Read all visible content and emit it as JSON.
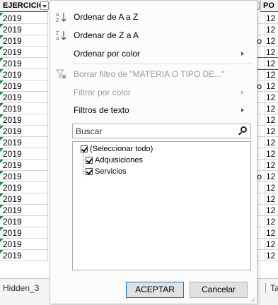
{
  "sheet": {
    "header_left": "EJERCICIO",
    "header_right": "PO",
    "left_values": [
      "2019",
      "2019",
      "2019",
      "2019",
      "2019",
      "2019",
      "2019",
      "2019",
      "2019",
      "2019",
      "2019",
      "2019",
      "2019",
      "2019",
      "2019",
      "2019",
      "2019",
      "2019",
      "2019",
      "2019",
      "2019",
      "2019"
    ],
    "right_a": [
      "os",
      "os",
      "icio",
      "os",
      "os",
      "os",
      "icio",
      "os",
      "os",
      "os",
      "os",
      "os",
      "os",
      "os",
      "icio",
      "os",
      "os",
      "os",
      "os",
      "os",
      "os",
      "os"
    ],
    "right_b": [
      "12",
      "12",
      "12",
      "12",
      "12",
      "12",
      "12",
      "12",
      "12",
      "12",
      "12",
      "12",
      "12",
      "12",
      "12",
      "12",
      "12",
      "12",
      "12",
      "12",
      "12",
      "12"
    ],
    "tab_left": "Hidden_3",
    "tab_right": "Ta"
  },
  "menu": {
    "sort_az": "Ordenar de A a Z",
    "sort_za": "Ordenar de Z a A",
    "sort_color": "Ordenar por color",
    "clear_filter": "Borrar filtro de \"MATERIA O TIPO DE...\"",
    "filter_color": "Filtrar por color",
    "text_filters": "Filtros de texto",
    "search_placeholder": "Buscar",
    "items": [
      "(Seleccionar todo)",
      "Adquisiciones",
      "Servicios"
    ],
    "ok": "ACEPTAR",
    "cancel": "Cancelar"
  },
  "colors": {
    "accent_green": "#1e8a3a",
    "focus_blue": "#0078d7"
  },
  "icons": [
    "sort-az-icon",
    "sort-za-icon",
    "clear-filter-icon",
    "search-icon",
    "checkbox-checked-icon",
    "submenu-arrow-icon",
    "filter-dropdown-icon"
  ]
}
